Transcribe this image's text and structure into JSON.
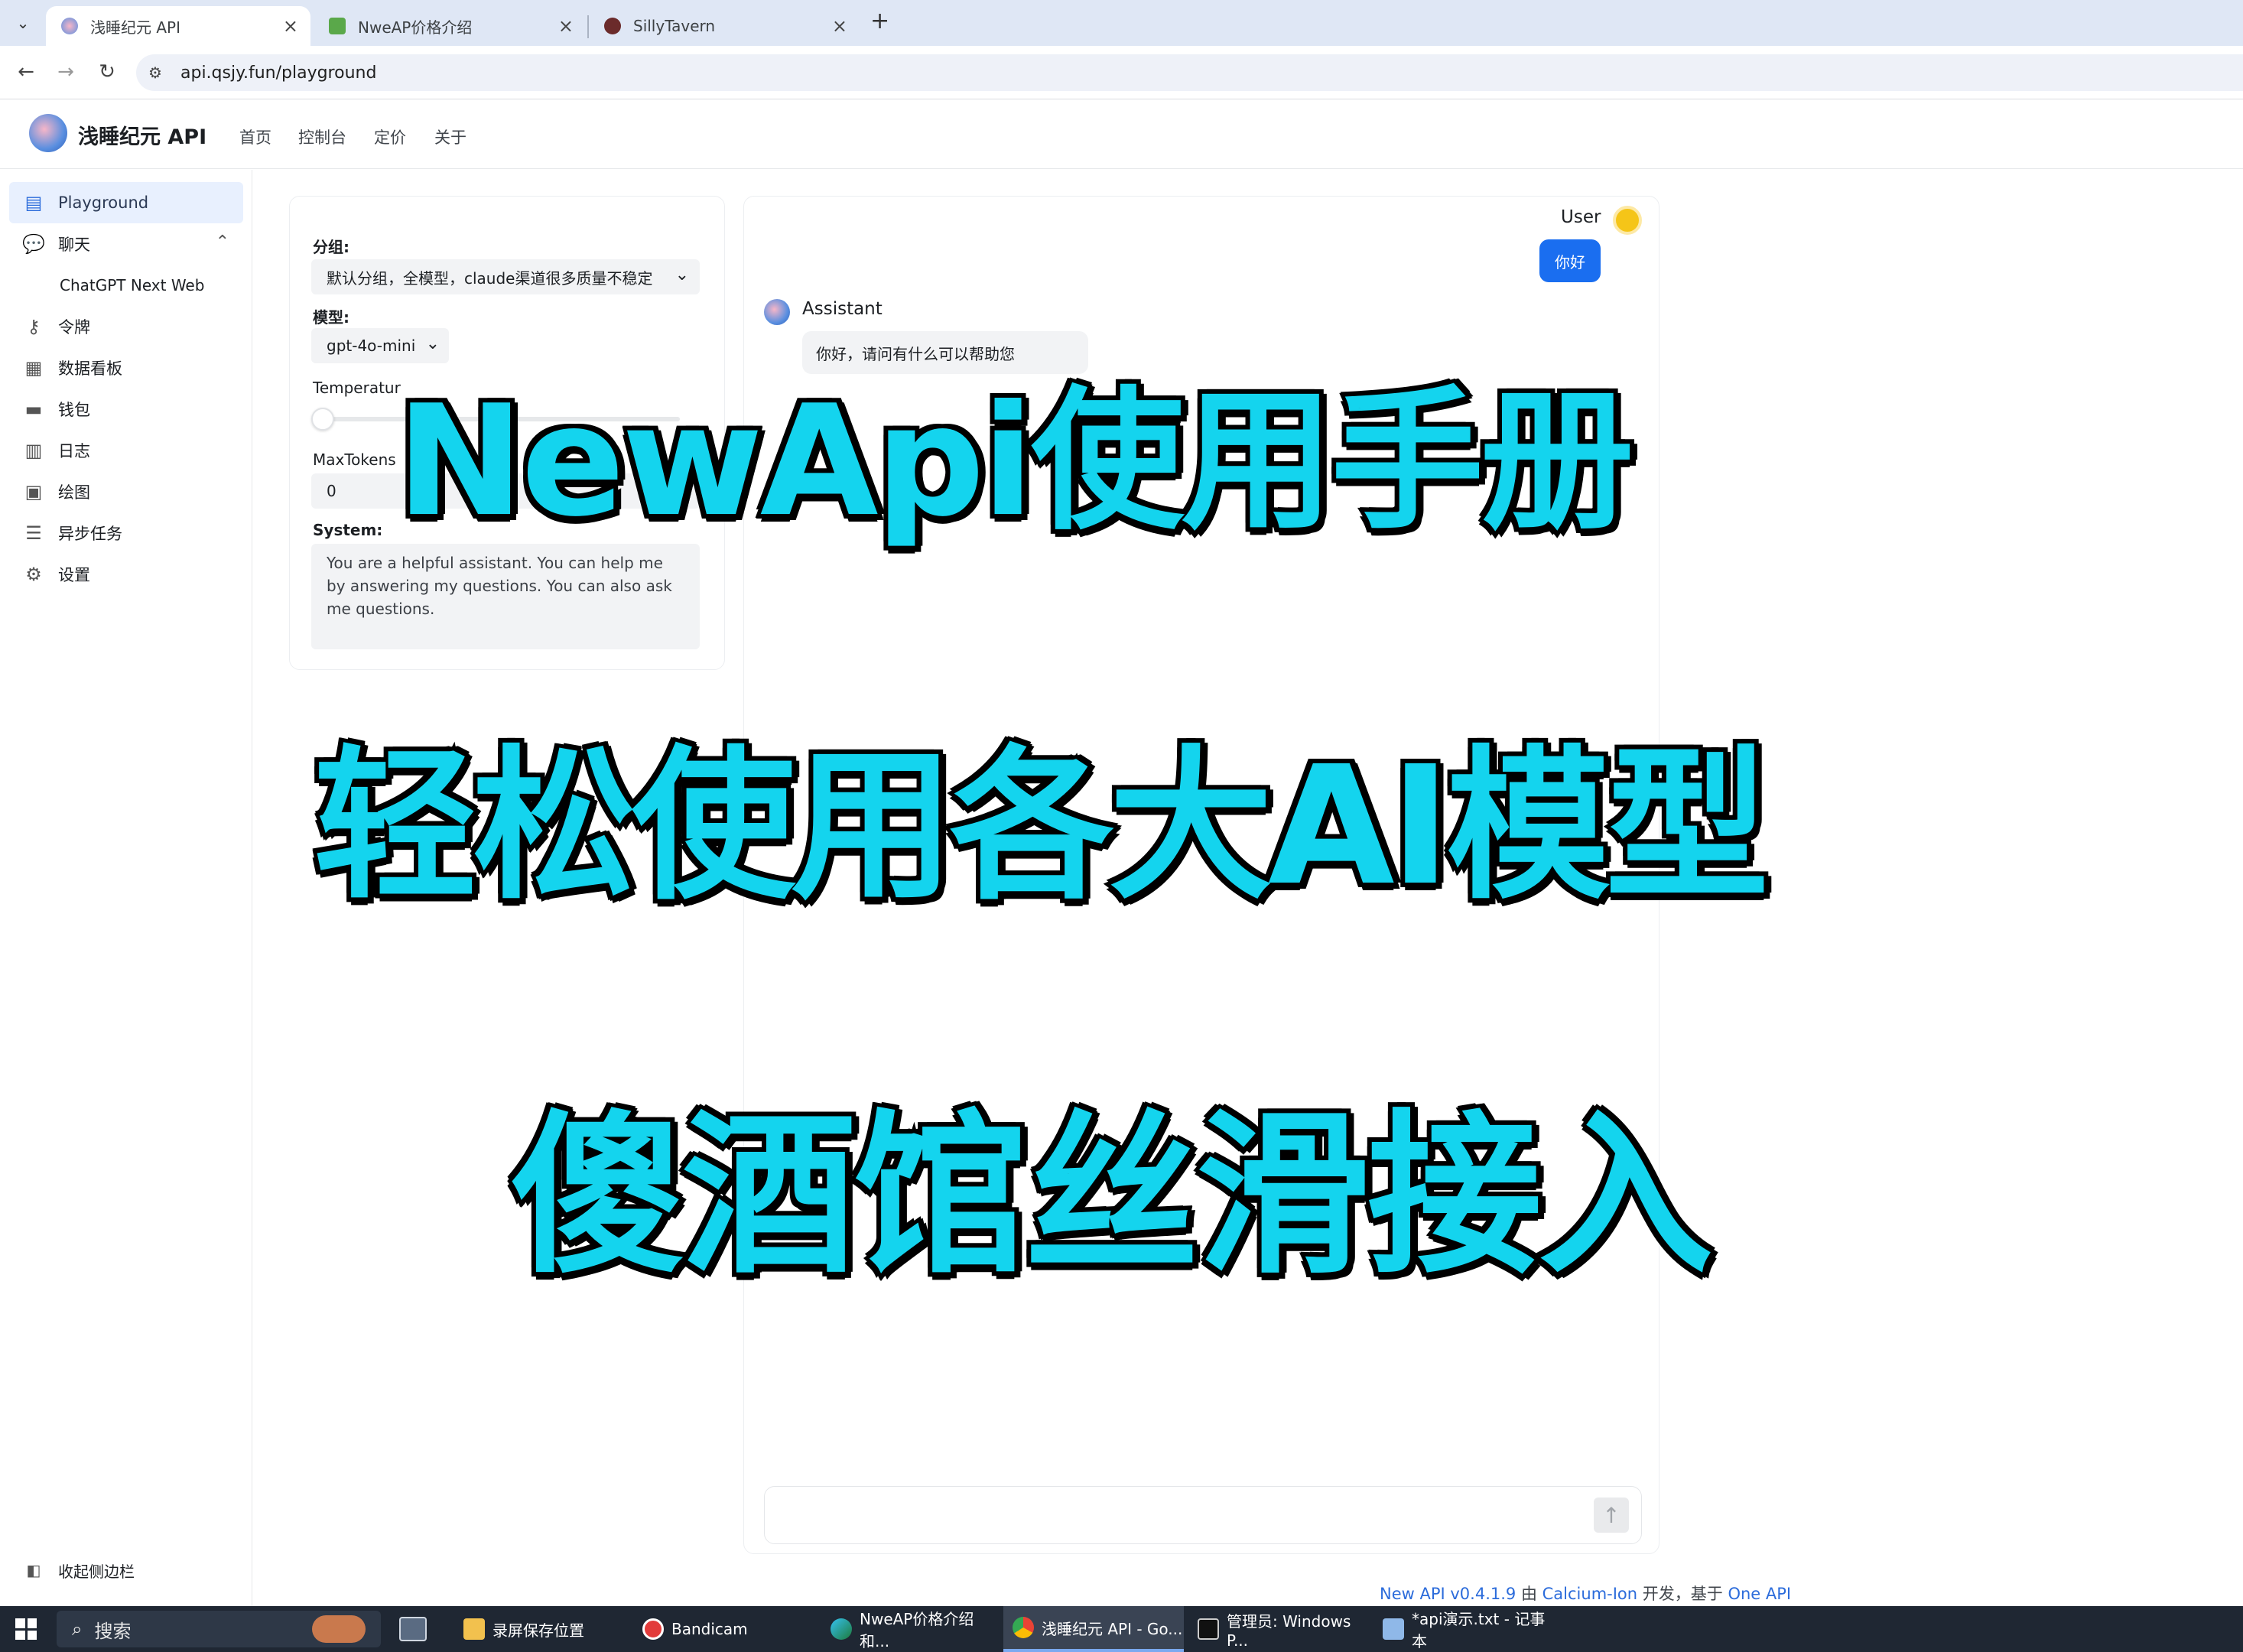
{
  "browser": {
    "tabs": [
      {
        "title": "浅睡纪元 API",
        "active": true
      },
      {
        "title": "NweAP价格介绍",
        "active": false
      },
      {
        "title": "SillyTavern",
        "active": false
      }
    ],
    "new_tab": "+",
    "url": "api.qsjy.fun/playground"
  },
  "header": {
    "brand": "浅睡纪元 API",
    "nav": [
      "首页",
      "控制台",
      "定价",
      "关于"
    ]
  },
  "sidebar": {
    "items": [
      {
        "label": "Playground",
        "icon": "chat-square-icon",
        "active": true
      },
      {
        "label": "聊天",
        "icon": "chat-bubble-icon"
      },
      {
        "label": "ChatGPT Next Web",
        "icon": ""
      },
      {
        "label": "令牌",
        "icon": "key-icon"
      },
      {
        "label": "数据看板",
        "icon": "dashboard-icon"
      },
      {
        "label": "钱包",
        "icon": "wallet-icon"
      },
      {
        "label": "日志",
        "icon": "bar-chart-icon"
      },
      {
        "label": "绘图",
        "icon": "image-icon"
      },
      {
        "label": "异步任务",
        "icon": "task-list-icon"
      },
      {
        "label": "设置",
        "icon": "gear-icon"
      }
    ],
    "collapse_label": "收起侧边栏"
  },
  "settings": {
    "group_label": "分组:",
    "group_value": "默认分组，全模型，claude渠道很多质量不稳定",
    "model_label": "模型:",
    "model_value": "gpt-4o-mini",
    "temperature_label": "Temperatur",
    "maxtokens_label": "MaxTokens",
    "maxtokens_value": "0",
    "system_label": "System:",
    "system_value": "You are a helpful assistant. You can help me by answering my questions. You can also ask me questions."
  },
  "chat": {
    "user_name": "User",
    "user_message": "你好",
    "assistant_name": "Assistant",
    "assistant_message": "你好，请问有什么可以帮助您"
  },
  "overlay": {
    "line1": "NewApi使用手册",
    "line2": "轻松使用各大AI模型",
    "line3": "傻酒馆丝滑接入"
  },
  "footer": {
    "version": "New API v0.4.1.9",
    "by": " 由 ",
    "author": "Calcium-Ion",
    "dev": " 开发，基于 ",
    "base": "One API"
  },
  "taskbar": {
    "search": "搜索",
    "items": [
      {
        "label": "录屏保存位置",
        "icon": "folder-icon"
      },
      {
        "label": "Bandicam",
        "icon": "record-icon"
      },
      {
        "label": "NweAP价格介绍 和...",
        "icon": "edge-icon"
      },
      {
        "label": "浅睡纪元 API - Go...",
        "icon": "chrome-icon",
        "active": true
      },
      {
        "label": "管理员: Windows P...",
        "icon": "terminal-icon"
      },
      {
        "label": "*api演示.txt - 记事本",
        "icon": "notepad-icon"
      }
    ]
  }
}
